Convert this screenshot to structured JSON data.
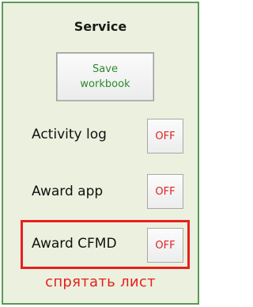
{
  "panel": {
    "title": "Service",
    "save_button_label": "Save\nworkbook",
    "rows": [
      {
        "label": "Activity log",
        "toggle": "OFF"
      },
      {
        "label": "Award app",
        "toggle": "OFF"
      },
      {
        "label": "Award CFMD",
        "toggle": "OFF"
      }
    ],
    "hide_sheet_note": "спрятать лист"
  },
  "colors": {
    "panel_background": "#ebf1de",
    "panel_border": "#5a9a55",
    "save_text": "#2d8a2d",
    "toggle_text": "#e02020",
    "highlight_border": "#e62020"
  }
}
